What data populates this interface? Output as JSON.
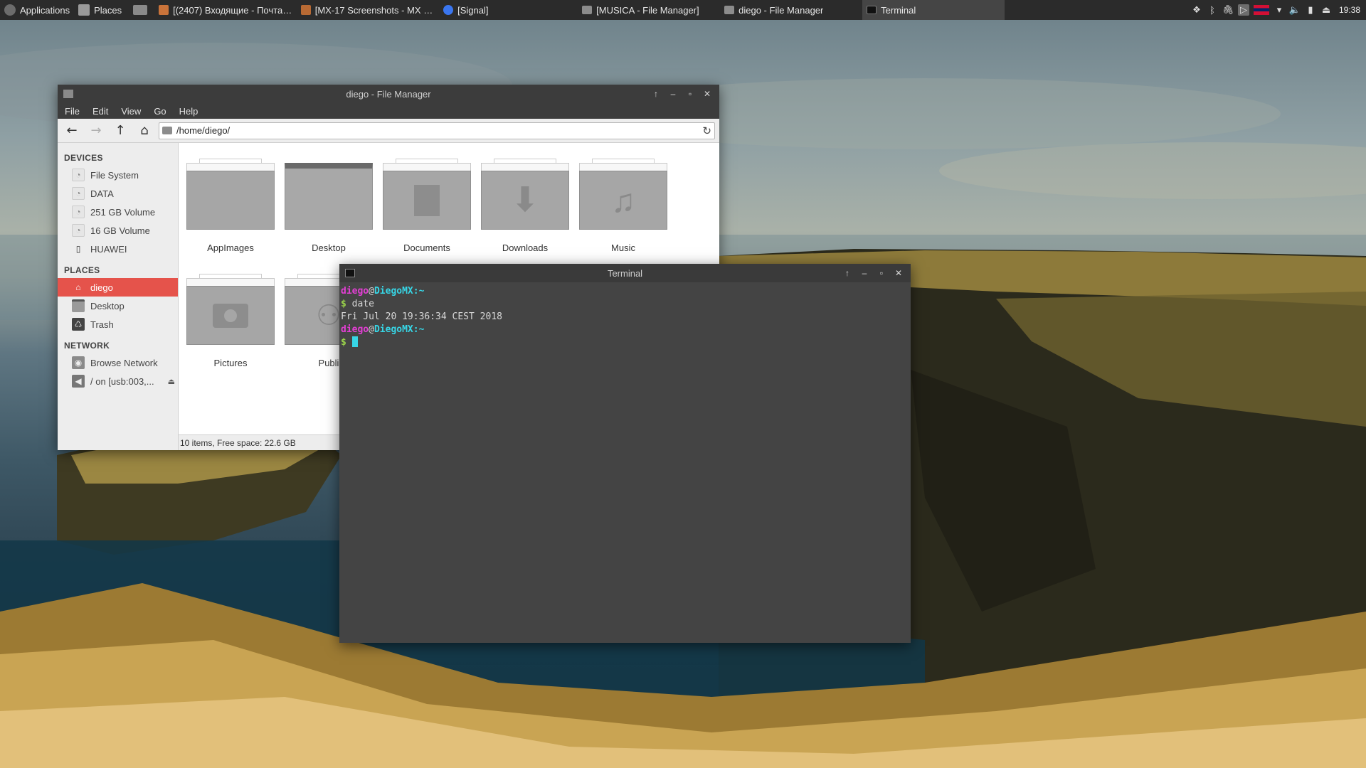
{
  "panel": {
    "applications_label": "Applications",
    "places_label": "Places",
    "tasks": [
      {
        "label": "[(2407) Входящие - Почта ..."
      },
      {
        "label": "[MX-17 Screenshots - MX Li..."
      },
      {
        "label": "[Signal]"
      },
      {
        "label": "[MUSICA - File Manager]"
      },
      {
        "label": "diego - File Manager"
      },
      {
        "label": "Terminal"
      }
    ],
    "clock": "19:38"
  },
  "file_manager": {
    "title": "diego - File Manager",
    "menu": [
      "File",
      "Edit",
      "View",
      "Go",
      "Help"
    ],
    "path": "/home/diego/",
    "sidebar": {
      "devices_header": "DEVICES",
      "devices": [
        "File System",
        "DATA",
        "251 GB Volume",
        "16 GB Volume",
        "HUAWEI"
      ],
      "places_header": "PLACES",
      "places": [
        "diego",
        "Desktop",
        "Trash"
      ],
      "network_header": "NETWORK",
      "network": [
        "Browse Network",
        "/ on [usb:003,..."
      ]
    },
    "items": [
      "AppImages",
      "Desktop",
      "Documents",
      "Downloads",
      "Music",
      "Pictures",
      "Publi"
    ],
    "status": "10 items, Free space: 22.6 GB"
  },
  "terminal": {
    "title": "Terminal",
    "user": "diego",
    "at": "@",
    "host": "DiegoMX",
    "suffix": ":~",
    "dollar": "$",
    "command": " date",
    "output": "Fri Jul 20 19:36:34 CEST 2018"
  },
  "colors": {
    "accent_selected": "#e5534b",
    "prompt_user": "#e33fd4",
    "prompt_host": "#37d6e6",
    "prompt_dollar": "#9ad34a"
  }
}
